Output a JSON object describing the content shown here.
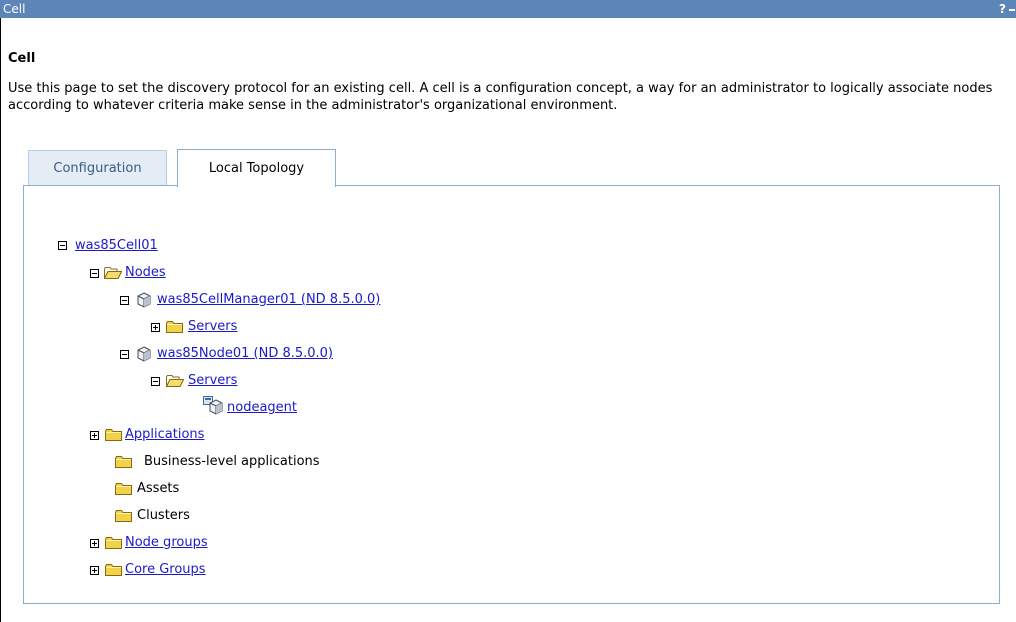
{
  "window": {
    "title": "Cell",
    "help_label": "?"
  },
  "page": {
    "heading": "Cell",
    "description": "Use this page to set the discovery protocol for an existing cell. A cell is a configuration concept, a way for an administrator to logically associate nodes according to whatever criteria make sense in the administrator's organizational environment."
  },
  "tabs": [
    {
      "label": "Configuration",
      "selected": false
    },
    {
      "label": "Local Topology",
      "selected": true
    }
  ],
  "tree": {
    "cell": {
      "label": "was85Cell01",
      "expanded": true
    },
    "nodes_folder": {
      "label": "Nodes",
      "expanded": true
    },
    "cell_manager": {
      "label": "was85CellManager01 (ND 8.5.0.0)",
      "expanded": true
    },
    "cm_servers": {
      "label": "Servers",
      "expanded": false
    },
    "node01": {
      "label": "was85Node01 (ND 8.5.0.0)",
      "expanded": true
    },
    "node_servers": {
      "label": "Servers",
      "expanded": true
    },
    "nodeagent": {
      "label": "nodeagent"
    },
    "applications": {
      "label": "Applications",
      "expanded": false
    },
    "business_level_apps": {
      "label": "Business-level applications"
    },
    "assets": {
      "label": "Assets"
    },
    "clusters": {
      "label": "Clusters"
    },
    "node_groups": {
      "label": "Node groups",
      "expanded": false
    },
    "core_groups": {
      "label": "Core Groups",
      "expanded": false
    }
  },
  "colors": {
    "titlebar": "#5d85b8",
    "link": "#1a1acd",
    "tab_border": "#8aaed0",
    "folder": "#f1d24a"
  }
}
